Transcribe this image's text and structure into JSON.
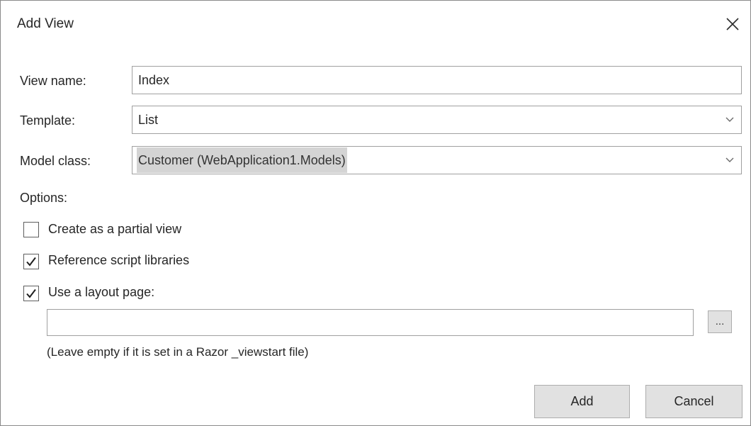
{
  "dialog": {
    "title": "Add View",
    "close_icon": "close-icon"
  },
  "fields": {
    "view_name_label": "View name:",
    "view_name_value": "Index",
    "template_label": "Template:",
    "template_value": "List",
    "model_class_label": "Model class:",
    "model_class_value": "Customer (WebApplication1.Models)"
  },
  "options": {
    "heading": "Options:",
    "partial_view": {
      "label": "Create as a partial view",
      "checked": false
    },
    "reference_scripts": {
      "label": "Reference script libraries",
      "checked": true
    },
    "use_layout": {
      "label": "Use a layout page:",
      "checked": true
    },
    "layout_path_value": "",
    "browse_label": "...",
    "hint": "(Leave empty if it is set in a Razor _viewstart file)"
  },
  "buttons": {
    "add_label": "Add",
    "cancel_label": "Cancel"
  }
}
